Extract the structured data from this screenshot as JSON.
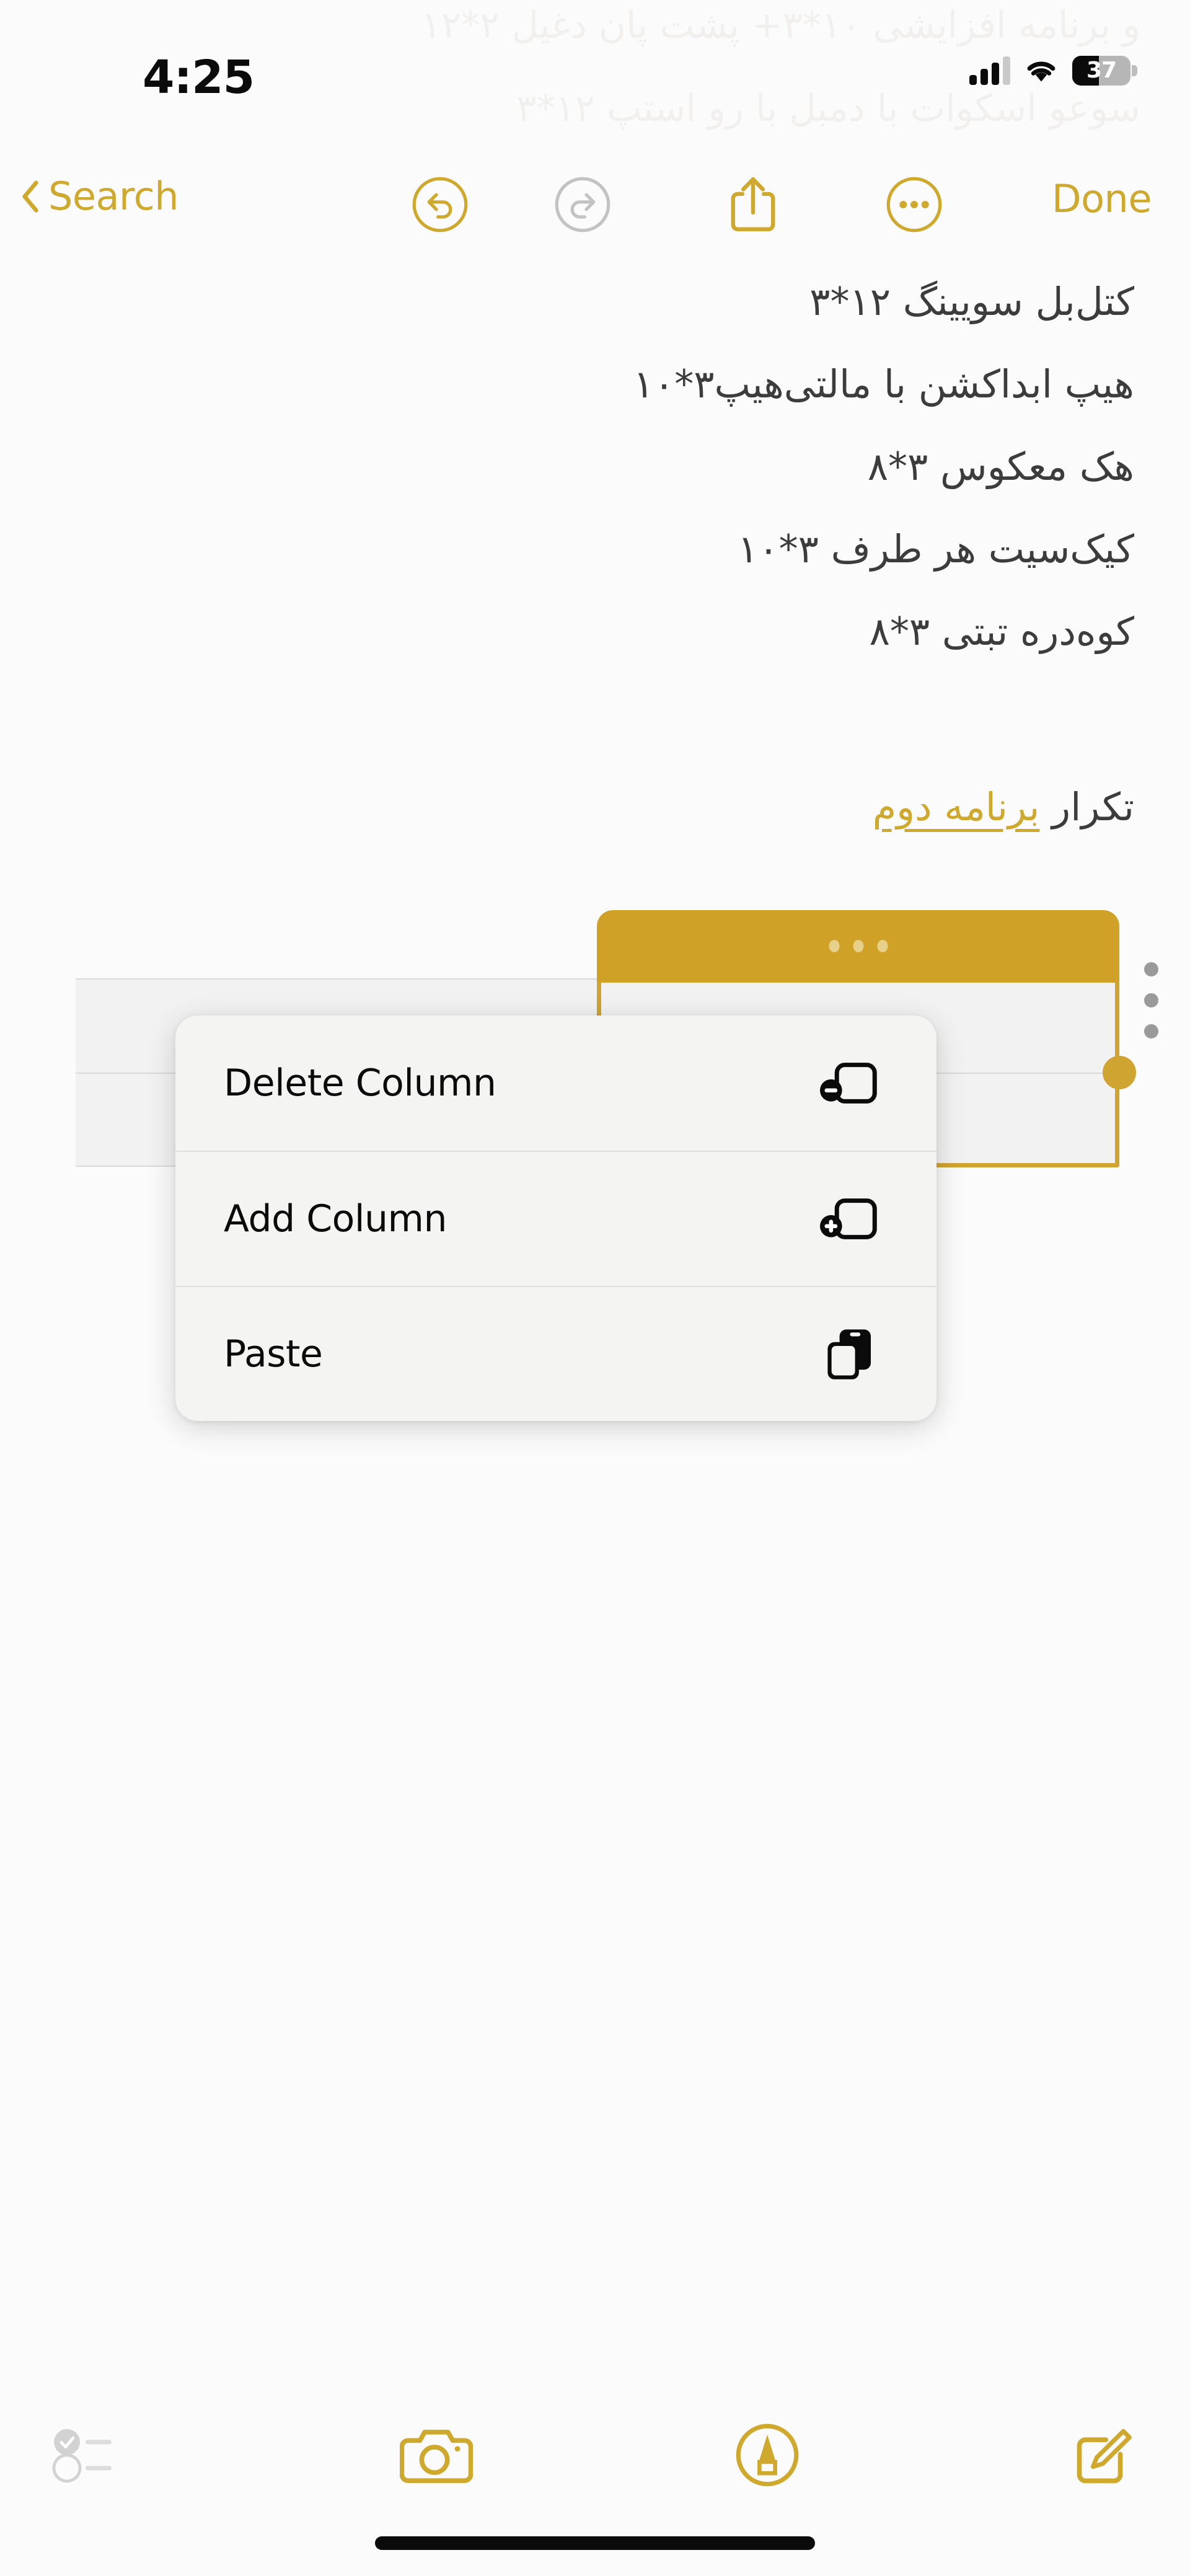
{
  "status_bar": {
    "time": "4:25",
    "battery_percent": "37",
    "cellular_icon": "cellular-bars-icon",
    "wifi_icon": "wifi-icon",
    "battery_icon": "battery-icon"
  },
  "ghost_text": {
    "line1": "و برنامه افزایشی ۱۰*۳+ پشت پان دغیل ۲*۱۲",
    "line2": "سوعو اسکوات با دمبل با رو استپ ۱۲*۳"
  },
  "nav_toolbar": {
    "back_label": "Search",
    "back_icon": "chevron-left-icon",
    "undo_icon": "undo-icon",
    "redo_icon": "redo-icon",
    "share_icon": "share-icon",
    "more_icon": "ellipsis-circle-icon",
    "done_label": "Done"
  },
  "note": {
    "lines": [
      "کتل‌بل سویینگ  ۱۲*۳",
      "هیپ ابداکشن با مالتی‌هیپ۳*۱۰",
      "هک معکوس ۳*۸",
      "کیک‌سیت هر طرف ۳*۱۰",
      "کوه‌دره تبتی ۳*۸"
    ],
    "link_line": {
      "prefix": "تکرار ",
      "link_text": "برنامه دوم"
    }
  },
  "table": {
    "rows": 2,
    "columns": 2,
    "selected_column_index": 1,
    "column_handle_icon": "column-drag-handle",
    "resize_handle_icon": "column-resize-handle-icon",
    "row_handle_icon": "row-menu-dots-icon"
  },
  "context_menu": {
    "items": [
      {
        "label": "Delete Column",
        "icon": "delete-column-icon"
      },
      {
        "label": "Add Column",
        "icon": "add-column-icon"
      },
      {
        "label": "Paste",
        "icon": "paste-icon"
      }
    ]
  },
  "bottom_bar": {
    "checklist_icon": "checklist-icon",
    "camera_icon": "camera-icon",
    "markup_icon": "markup-pen-icon",
    "compose_icon": "compose-icon"
  },
  "colors": {
    "accent_gold": "#cfa92e",
    "table_gold": "#cfa227",
    "disabled_gray": "#c3c3c3",
    "text_dark": "#3c3c3c",
    "background": "#fbfbfb"
  }
}
